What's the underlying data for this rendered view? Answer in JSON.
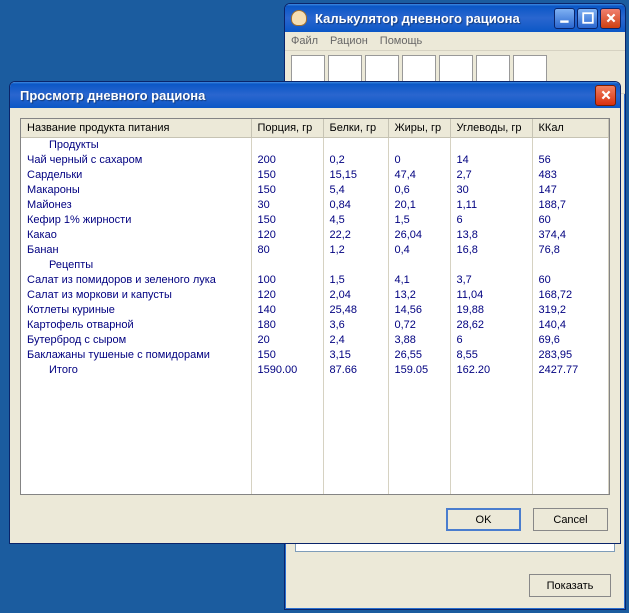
{
  "back_window": {
    "title": "Калькулятор дневного рациона",
    "menu": [
      "Файл",
      "Рацион",
      "Помощь"
    ],
    "show_button": "Показать"
  },
  "dialog": {
    "title": "Просмотр дневного рациона",
    "ok": "OK",
    "cancel": "Cancel"
  },
  "columns": {
    "name": "Название продукта питания",
    "portion": "Порция, гр",
    "protein": "Белки, гр",
    "fat": "Жиры, гр",
    "carbs": "Углеводы, гр",
    "kcal": "ККал"
  },
  "sections": {
    "products": "Продукты",
    "recipes": "Рецепты",
    "total": "Итого"
  },
  "rows": {
    "products": [
      {
        "name": "Чай черный с сахаром",
        "portion": "200",
        "protein": "0,2",
        "fat": "0",
        "carbs": "14",
        "kcal": "56"
      },
      {
        "name": "Сардельки",
        "portion": "150",
        "protein": "15,15",
        "fat": "47,4",
        "carbs": "2,7",
        "kcal": "483"
      },
      {
        "name": "Макароны",
        "portion": "150",
        "protein": "5,4",
        "fat": "0,6",
        "carbs": "30",
        "kcal": "147"
      },
      {
        "name": "Майонез",
        "portion": "30",
        "protein": "0,84",
        "fat": "20,1",
        "carbs": "1,11",
        "kcal": "188,7"
      },
      {
        "name": "Кефир 1% жирности",
        "portion": "150",
        "protein": "4,5",
        "fat": "1,5",
        "carbs": "6",
        "kcal": "60"
      },
      {
        "name": "Какао",
        "portion": "120",
        "protein": "22,2",
        "fat": "26,04",
        "carbs": "13,8",
        "kcal": "374,4"
      },
      {
        "name": "Банан",
        "portion": "80",
        "protein": "1,2",
        "fat": "0,4",
        "carbs": "16,8",
        "kcal": "76,8"
      }
    ],
    "recipes": [
      {
        "name": "Салат из помидоров и зеленого лука",
        "portion": "100",
        "protein": "1,5",
        "fat": "4,1",
        "carbs": "3,7",
        "kcal": "60"
      },
      {
        "name": "Салат из моркови и капусты",
        "portion": "120",
        "protein": "2,04",
        "fat": "13,2",
        "carbs": "11,04",
        "kcal": "168,72"
      },
      {
        "name": "Котлеты куриные",
        "portion": "140",
        "protein": "25,48",
        "fat": "14,56",
        "carbs": "19,88",
        "kcal": "319,2"
      },
      {
        "name": "Картофель отварной",
        "portion": "180",
        "protein": "3,6",
        "fat": "0,72",
        "carbs": "28,62",
        "kcal": "140,4"
      },
      {
        "name": "Бутерброд с сыром",
        "portion": "20",
        "protein": "2,4",
        "fat": "3,88",
        "carbs": "6",
        "kcal": "69,6"
      },
      {
        "name": "Баклажаны тушеные с помидорами",
        "portion": "150",
        "protein": "3,15",
        "fat": "26,55",
        "carbs": "8,55",
        "kcal": "283,95"
      }
    ],
    "total": {
      "portion": "1590.00",
      "protein": "87.66",
      "fat": "159.05",
      "carbs": "162.20",
      "kcal": "2427.77"
    }
  }
}
